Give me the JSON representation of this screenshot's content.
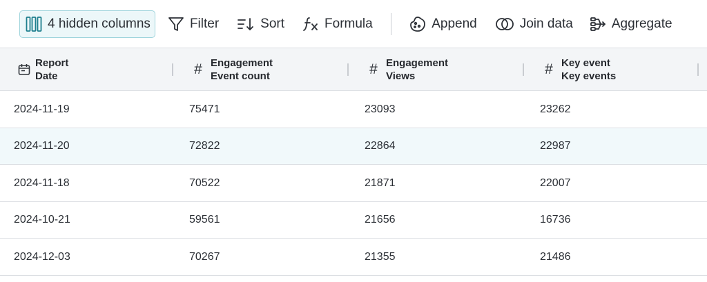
{
  "toolbar": {
    "hidden_columns": "4 hidden columns",
    "filter": "Filter",
    "sort": "Sort",
    "formula": "Formula",
    "append": "Append",
    "join": "Join data",
    "aggregate": "Aggregate"
  },
  "columns": [
    {
      "icon": "calendar-icon",
      "line1": "Report",
      "line2": "Date"
    },
    {
      "icon": "hash-icon",
      "line1": "Engagement",
      "line2": "Event count"
    },
    {
      "icon": "hash-icon",
      "line1": "Engagement",
      "line2": "Views"
    },
    {
      "icon": "hash-icon",
      "line1": "Key event",
      "line2": "Key events"
    }
  ],
  "rows": [
    [
      "2024-11-19",
      "75471",
      "23093",
      "23262"
    ],
    [
      "2024-11-20",
      "72822",
      "22864",
      "22987"
    ],
    [
      "2024-11-18",
      "70522",
      "21871",
      "22007"
    ],
    [
      "2024-10-21",
      "59561",
      "21656",
      "16736"
    ],
    [
      "2024-12-03",
      "70267",
      "21355",
      "21486"
    ]
  ],
  "colors": {
    "accent": "#9fd4dc",
    "highlight_row": "#f1f9fb",
    "header_bg": "#f3f5f7"
  }
}
